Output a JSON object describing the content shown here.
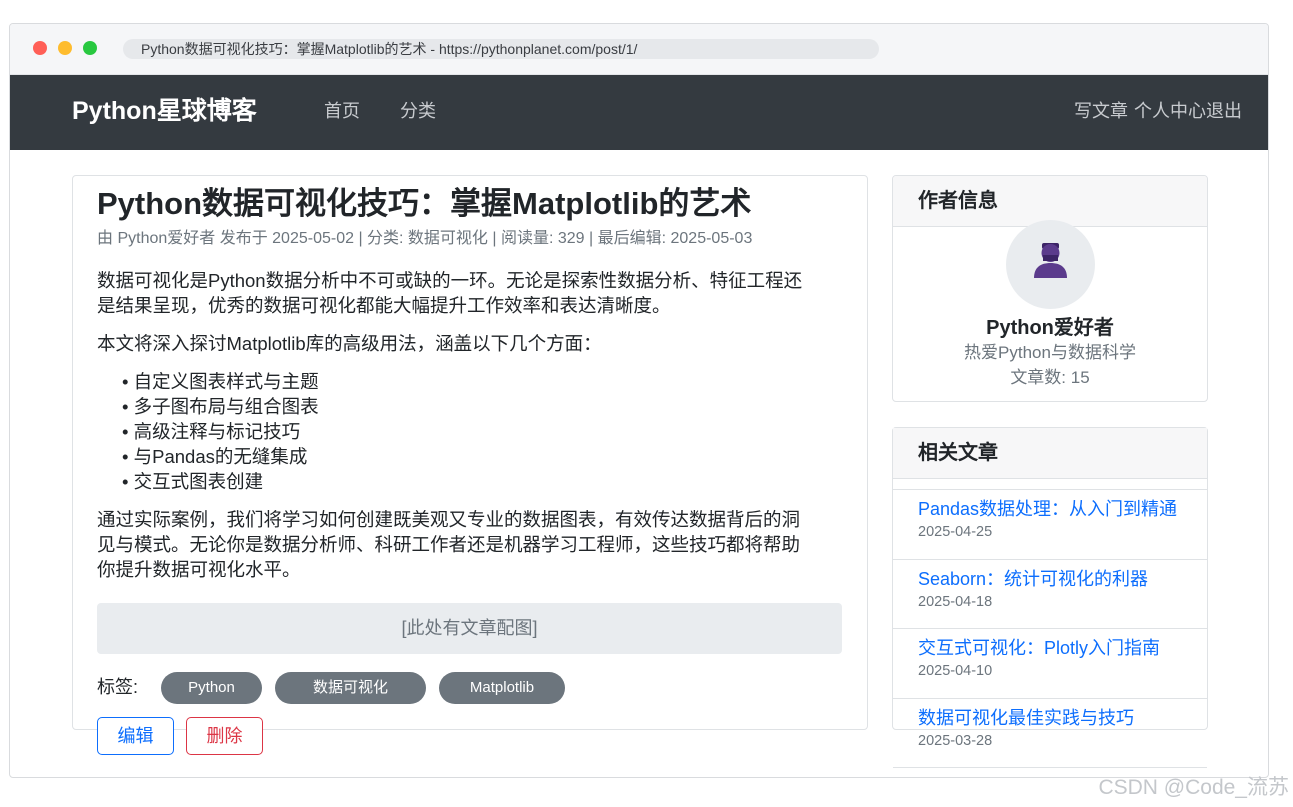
{
  "browser": {
    "url": "Python数据可视化技巧：掌握Matplotlib的艺术 - https://pythonplanet.com/post/1/"
  },
  "navbar": {
    "brand": "Python星球博客",
    "home": "首页",
    "category": "分类",
    "write": "写文章",
    "profile": "个人中心",
    "logout": "退出"
  },
  "article": {
    "title": "Python数据可视化技巧：掌握Matplotlib的艺术",
    "meta": "由 Python爱好者 发布于 2025-05-02 | 分类: 数据可视化 | 阅读量: 329 | 最后编辑: 2025-05-03",
    "para1": "数据可视化是Python数据分析中不可或缺的一环。无论是探索性数据分析、特征工程还是结果呈现，优秀的数据可视化都能大幅提升工作效率和表达清晰度。",
    "para2": "本文将深入探讨Matplotlib库的高级用法，涵盖以下几个方面：",
    "bullets": [
      "自定义图表样式与主题",
      "多子图布局与组合图表",
      "高级注释与标记技巧",
      "与Pandas的无缝集成",
      "交互式图表创建"
    ],
    "para3": "通过实际案例，我们将学习如何创建既美观又专业的数据图表，有效传达数据背后的洞见与模式。无论你是数据分析师、科研工作者还是机器学习工程师，这些技巧都将帮助你提升数据可视化水平。",
    "figure_placeholder": "[此处有文章配图]",
    "tags_label": "标签:",
    "tags": [
      "Python",
      "数据可视化",
      "Matplotlib"
    ],
    "edit_label": "编辑",
    "delete_label": "删除"
  },
  "author": {
    "header": "作者信息",
    "name": "Python爱好者",
    "bio": "热爱Python与数据科学",
    "count": "文章数: 15"
  },
  "related": {
    "header": "相关文章",
    "items": [
      {
        "title": "Pandas数据处理：从入门到精通",
        "date": "2025-04-25"
      },
      {
        "title": "Seaborn：统计可视化的利器",
        "date": "2025-04-18"
      },
      {
        "title": "交互式可视化：Plotly入门指南",
        "date": "2025-04-10"
      },
      {
        "title": "数据可视化最佳实践与技巧",
        "date": "2025-03-28"
      }
    ]
  },
  "colors": {
    "navbar": "#343a40",
    "link": "#0d6efd",
    "tag": "#6c757d",
    "danger": "#dc3545",
    "avatar_icon": "#5b3b8c"
  },
  "icons": {
    "avatar": "user-avatar-icon"
  },
  "watermark": "CSDN @Code_流苏"
}
